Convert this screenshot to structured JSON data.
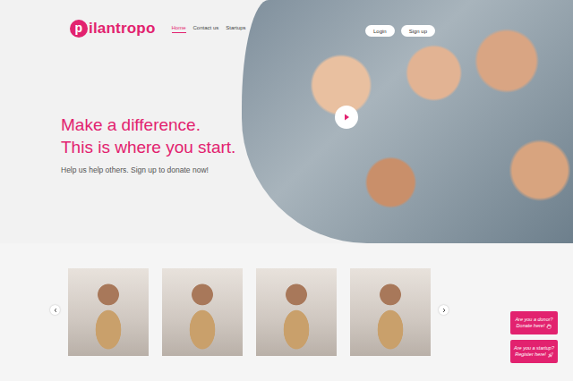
{
  "logo": {
    "mark": "p",
    "text": "ilantropo"
  },
  "nav": [
    {
      "label": "Home",
      "selected": true
    },
    {
      "label": "Contact us",
      "selected": false
    },
    {
      "label": "Startups",
      "selected": false
    }
  ],
  "auth_buttons": [
    "Login",
    "Sign up"
  ],
  "hero": {
    "headline": [
      "Make a difference.",
      "This is where you start."
    ],
    "subtext": "Help us help others. Sign up to donate now!"
  },
  "carousel": {
    "slides": [
      {
        "kind": "photo"
      },
      {
        "kind": "photo"
      },
      {
        "kind": "photo"
      },
      {
        "kind": "photo"
      }
    ]
  },
  "cta": [
    {
      "lines": [
        "Are you a donor?",
        "Donate here!"
      ],
      "kind": "donor"
    },
    {
      "lines": [
        "Are you a startup?",
        "Register here!"
      ],
      "kind": "startup"
    }
  ]
}
